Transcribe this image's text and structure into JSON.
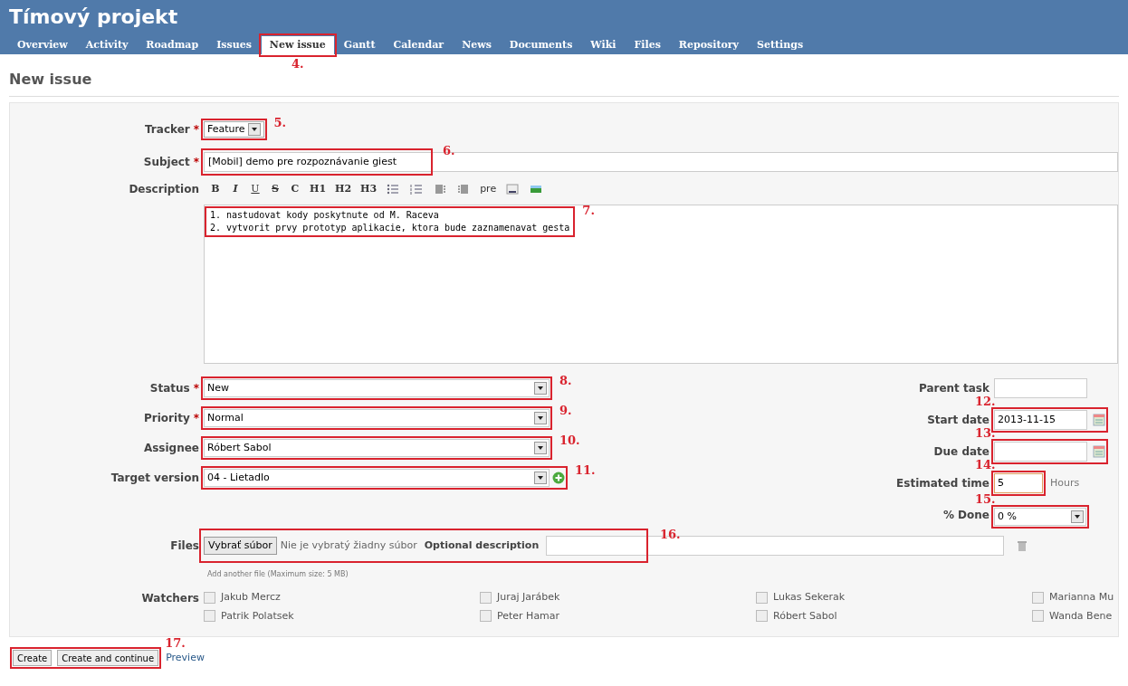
{
  "project_title": "Tímový projekt",
  "tabs": [
    {
      "label": "Overview",
      "selected": false
    },
    {
      "label": "Activity",
      "selected": false
    },
    {
      "label": "Roadmap",
      "selected": false
    },
    {
      "label": "Issues",
      "selected": false
    },
    {
      "label": "New issue",
      "selected": true,
      "callout": "4."
    },
    {
      "label": "Gantt",
      "selected": false
    },
    {
      "label": "Calendar",
      "selected": false
    },
    {
      "label": "News",
      "selected": false
    },
    {
      "label": "Documents",
      "selected": false
    },
    {
      "label": "Wiki",
      "selected": false
    },
    {
      "label": "Files",
      "selected": false
    },
    {
      "label": "Repository",
      "selected": false
    },
    {
      "label": "Settings",
      "selected": false
    }
  ],
  "page_title": "New issue",
  "tracker": {
    "label": "Tracker",
    "required_mark": "*",
    "value": "Feature",
    "callout": "5."
  },
  "subject": {
    "label": "Subject",
    "required_mark": "*",
    "value": "[Mobil] demo pre rozpoznávanie giest",
    "callout": "6."
  },
  "description": {
    "label": "Description",
    "callout": "7.",
    "value": "1. nastudovat kody poskytnute od M. Raceva\n2. vytvorit prvy prototyp aplikacie, ktora bude zaznamenavat gesta",
    "toolbar": [
      {
        "kind": "bold",
        "label": "B"
      },
      {
        "kind": "italic",
        "label": "I"
      },
      {
        "kind": "underline",
        "label": "U"
      },
      {
        "kind": "strike",
        "label": "S"
      },
      {
        "kind": "code",
        "label": "C"
      },
      {
        "kind": "heading",
        "label": "H1"
      },
      {
        "kind": "heading",
        "label": "H2"
      },
      {
        "kind": "heading",
        "label": "H3"
      },
      {
        "kind": "ul"
      },
      {
        "kind": "ol"
      },
      {
        "kind": "indent-left"
      },
      {
        "kind": "indent-right"
      },
      {
        "kind": "pre",
        "label": "pre"
      },
      {
        "kind": "link"
      },
      {
        "kind": "image"
      }
    ]
  },
  "left_fields": [
    {
      "kind": "select",
      "label": "Status",
      "required_mark": "*",
      "value": "New",
      "callout": "8."
    },
    {
      "kind": "select",
      "label": "Priority",
      "required_mark": "*",
      "value": "Normal",
      "callout": "9."
    },
    {
      "kind": "select",
      "label": "Assignee",
      "value": "Róbert Sabol",
      "callout": "10."
    },
    {
      "kind": "select-add",
      "label": "Target version",
      "value": "04 - Lietadlo",
      "callout": "11."
    }
  ],
  "right_fields": [
    {
      "kind": "text",
      "label": "Parent task"
    },
    {
      "kind": "date",
      "label": "Start date",
      "value": "2013-11-15",
      "callout": "12."
    },
    {
      "kind": "date",
      "label": "Due date",
      "callout": "13."
    },
    {
      "kind": "hours",
      "label": "Estimated time",
      "value": "5",
      "unit": "Hours",
      "callout": "14."
    },
    {
      "kind": "select",
      "label": "% Done",
      "value": "0 %",
      "callout": "15."
    }
  ],
  "files": {
    "label": "Files",
    "button": "Vybrať súbor",
    "status": "Nie je vybratý žiadny súbor",
    "description_label": "Optional description",
    "callout": "16.",
    "hint": "Add another file (Maximum size: 5 MB)"
  },
  "watchers": {
    "label": "Watchers",
    "people": [
      {
        "name": "Jakub Mercz",
        "checked": false
      },
      {
        "name": "Juraj Jarábek",
        "checked": false
      },
      {
        "name": "Lukas Sekerak",
        "checked": false
      },
      {
        "name": "Marianna Mu",
        "checked": false
      },
      {
        "name": "Patrik Polatsek",
        "checked": false
      },
      {
        "name": "Peter Hamar",
        "checked": false
      },
      {
        "name": "Róbert Sabol",
        "checked": false
      },
      {
        "name": "Wanda Bene",
        "checked": false
      }
    ]
  },
  "actions": {
    "buttons": [
      "Create",
      "Create and continue"
    ],
    "callout": "17.",
    "link": "Preview"
  }
}
